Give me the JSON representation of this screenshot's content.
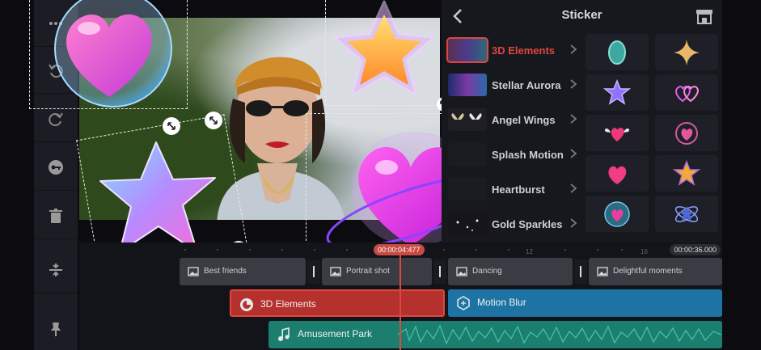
{
  "panel": {
    "title": "Sticker",
    "categories": [
      {
        "label": "3D Elements",
        "active": true
      },
      {
        "label": "Stellar Aurora",
        "active": false
      },
      {
        "label": "Angel Wings",
        "active": false
      },
      {
        "label": "Splash Motion",
        "active": false
      },
      {
        "label": "Heartburst",
        "active": false
      },
      {
        "label": "Gold Sparkles",
        "active": false
      }
    ],
    "stickers": [
      "teal-egg",
      "gold-sparkle",
      "purple-star",
      "double-hearts",
      "winged-heart",
      "heart-check",
      "pink-heart",
      "gold-star",
      "heart-orb",
      "orbit-star"
    ]
  },
  "timeline": {
    "current_time": "00:00:04:477",
    "total_time": "00:00:36.000",
    "ticks": [
      "12",
      "16"
    ],
    "video_clips": [
      "Best friends",
      "Portrait shot",
      "Dancing",
      "Delightful moments"
    ],
    "sticker_track": "3D Elements",
    "effect_track": "Motion Blur",
    "music_track": "Amusement Park"
  },
  "colors": {
    "accent": "#e0463f",
    "panel_bg": "#17181e",
    "effect": "#1d74a4",
    "music": "#1b7e6f"
  }
}
